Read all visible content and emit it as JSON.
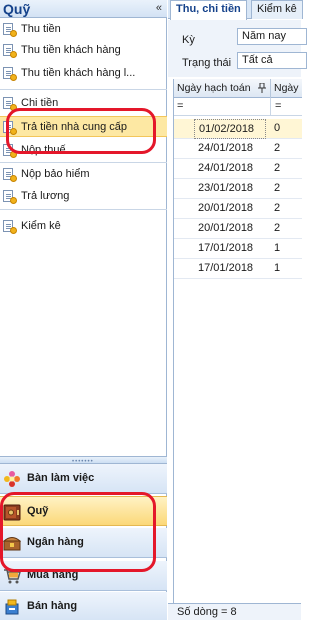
{
  "left_panel": {
    "title": "Quỹ",
    "collapse_glyph": "«",
    "items": [
      {
        "label": "Thu tiền",
        "icon": "document-coin-icon"
      },
      {
        "label": "Thu tiền khách hàng",
        "icon": "document-coin-icon"
      },
      {
        "label": "Thu tiền khách hàng l...",
        "icon": "document-coin-icon"
      },
      {
        "label": "Chi tiền",
        "icon": "document-coin-icon"
      },
      {
        "label": "Trả tiền nhà cung cấp",
        "icon": "document-coin-icon",
        "selected": true
      },
      {
        "label": "Nộp thuế",
        "icon": "document-coin-icon"
      },
      {
        "label": "Nộp bảo hiểm",
        "icon": "document-coin-icon"
      },
      {
        "label": "Trả lương",
        "icon": "document-coin-icon"
      },
      {
        "label": "Kiểm kê",
        "icon": "document-coin-icon"
      }
    ],
    "modules": [
      {
        "label": "Bàn làm việc",
        "icon": "flower-icon"
      },
      {
        "label": "Quỹ",
        "icon": "safe-icon",
        "selected": true
      },
      {
        "label": "Ngân hàng",
        "icon": "bank-chest-icon"
      },
      {
        "label": "Mua hàng",
        "icon": "cart-icon"
      },
      {
        "label": "Bán hàng",
        "icon": "sales-icon"
      }
    ]
  },
  "right_panel": {
    "tabs": [
      {
        "label": "Thu, chi tiền",
        "active": true
      },
      {
        "label": "Kiểm kê",
        "active": false
      }
    ],
    "filters": {
      "period_label": "Kỳ",
      "period_value": "Năm nay",
      "status_label": "Trạng thái",
      "status_value": "Tất cả"
    },
    "grid": {
      "columns": [
        "Ngày hạch toán",
        "Ngày"
      ],
      "filter_glyph": "=",
      "rows": [
        {
          "date": "01/02/2018",
          "next": "0"
        },
        {
          "date": "24/01/2018",
          "next": "2"
        },
        {
          "date": "24/01/2018",
          "next": "2"
        },
        {
          "date": "23/01/2018",
          "next": "2"
        },
        {
          "date": "20/01/2018",
          "next": "2"
        },
        {
          "date": "20/01/2018",
          "next": "2"
        },
        {
          "date": "17/01/2018",
          "next": "1"
        },
        {
          "date": "17/01/2018",
          "next": "1"
        }
      ]
    },
    "footer": "Số dòng = 8"
  },
  "colors": {
    "accent_blue": "#15428b",
    "selection_yellow": "#fde8a3",
    "annotation_red": "#e4172a"
  }
}
